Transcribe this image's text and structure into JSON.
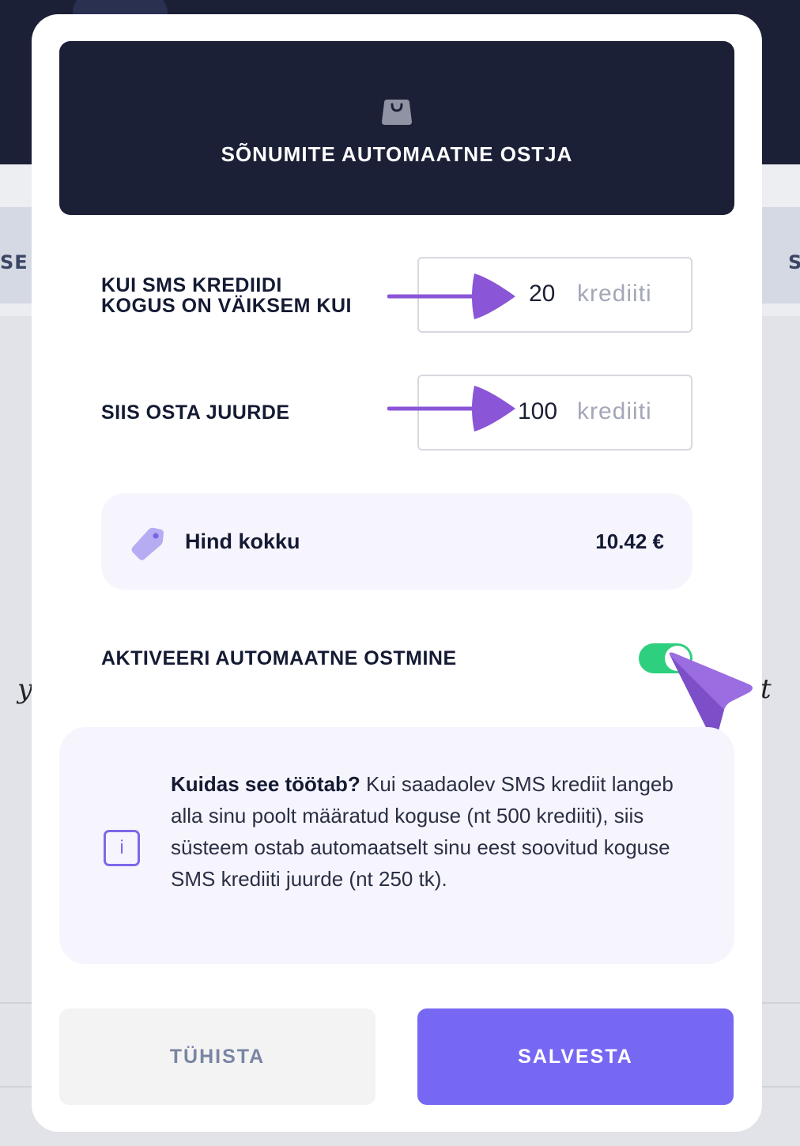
{
  "background": {
    "tab_left_text": "SE",
    "tab_right_text": "S",
    "glyph_left": "y",
    "glyph_right": "t"
  },
  "modal": {
    "header_icon": "shopping-bag-icon",
    "title": "SÕNUMITE AUTOMAATNE OSTJA",
    "threshold": {
      "label_line1": "KUI SMS KREDIIDI",
      "label_line2": "KOGUS ON VÄIKSEM KUI",
      "value": "20",
      "unit": "krediiti"
    },
    "purchase": {
      "label": "SIIS OSTA JUURDE",
      "value": "100",
      "unit": "krediiti"
    },
    "price": {
      "icon": "price-tag-icon",
      "label": "Hind kokku",
      "value": "10.42 €"
    },
    "auto_buy": {
      "label": "AKTIVEERI AUTOMAATNE OSTMINE",
      "enabled": true
    },
    "info": {
      "icon": "info-icon",
      "icon_glyph": "i",
      "title": "Kuidas see töötab?",
      "text": " Kui saadaolev SMS krediit langeb alla sinu poolt määratud koguse (nt 500 krediiti), siis süsteem ostab automaatselt sinu eest soovitud koguse SMS krediiti juurde (nt 250 tk)."
    },
    "buttons": {
      "cancel": "TÜHISTA",
      "save": "SALVESTA"
    }
  },
  "colors": {
    "header_bg": "#1b2037",
    "accent": "#7768f4",
    "toggle_on": "#2ecf7f",
    "annotation_arrow": "#8a55d6"
  }
}
